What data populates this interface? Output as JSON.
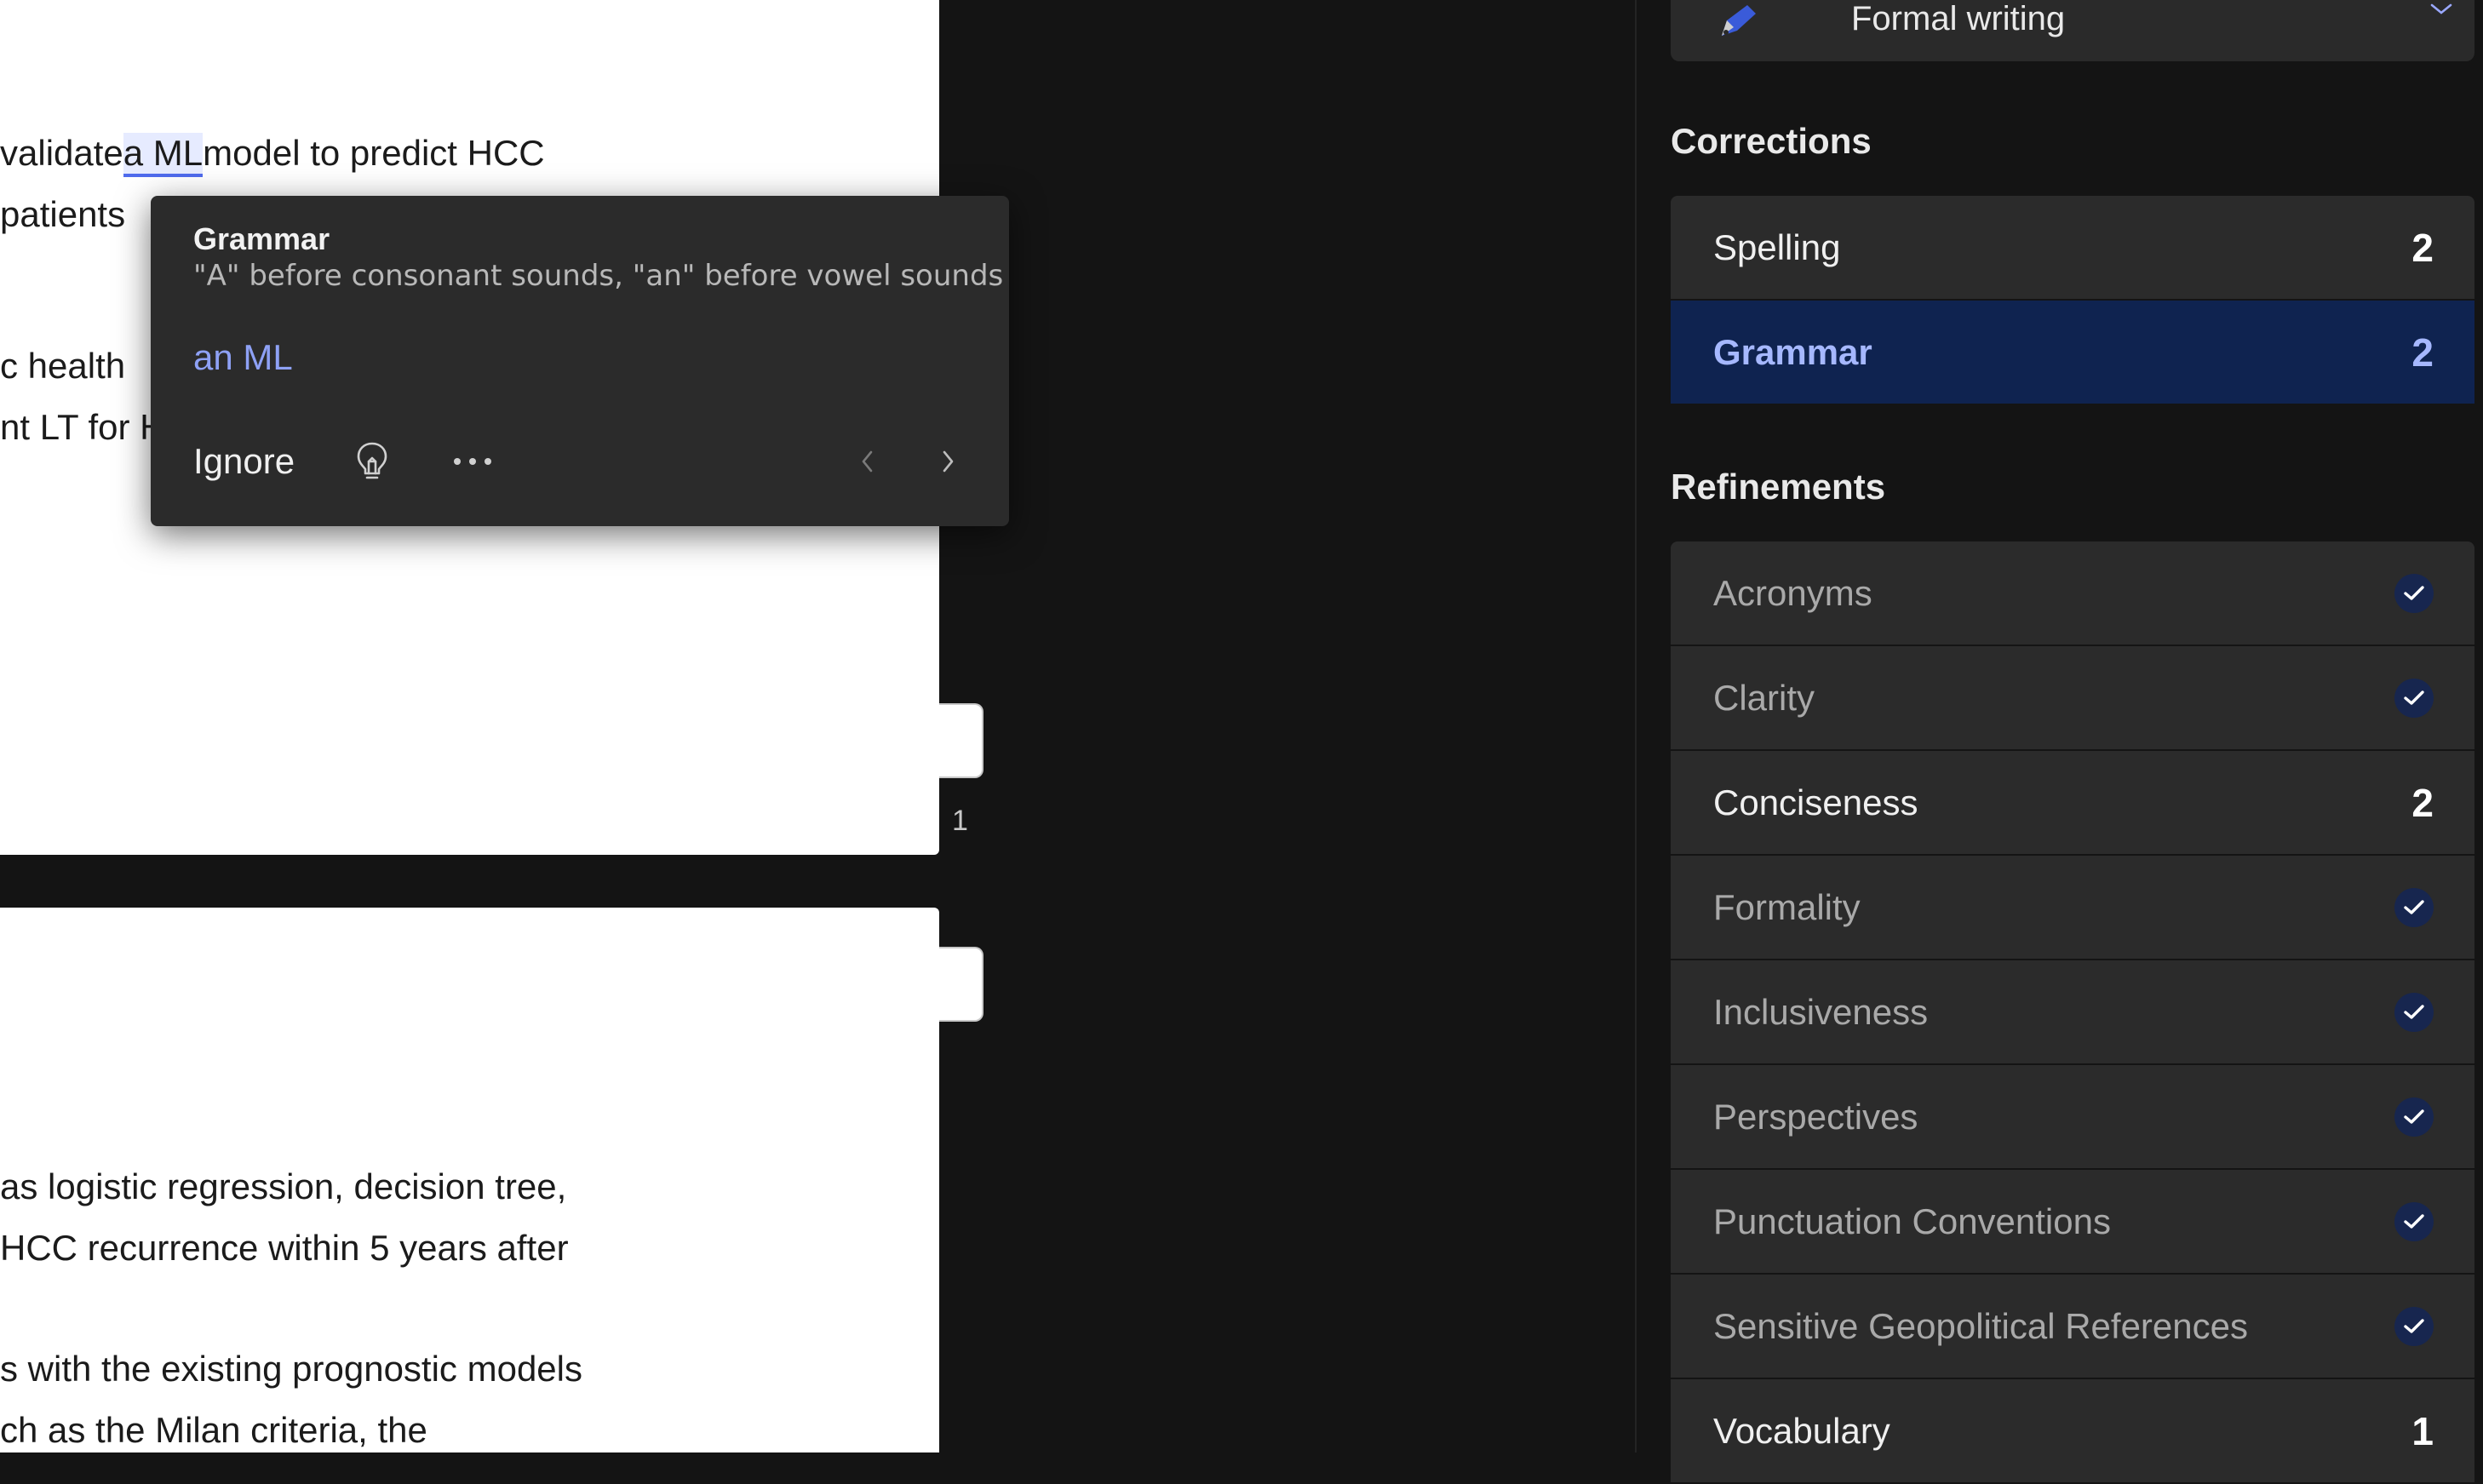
{
  "document": {
    "page1_lines": [
      {
        "before": "validate ",
        "flagged": "a ML",
        "after": " model to predict HCC"
      },
      {
        "before": "patients",
        "flagged": "",
        "after": ""
      },
      {
        "before": "c health",
        "flagged": "",
        "after": ""
      },
      {
        "before": "nt LT for H",
        "flagged": "",
        "after": ""
      }
    ],
    "page_number": "1",
    "page2_lines": [
      "as logistic regression, decision tree,",
      "HCC recurrence within 5 years after",
      "s with the existing prognostic models",
      "ch as the Milan criteria, the"
    ]
  },
  "card": {
    "category": "Grammar",
    "explanation": "\"A\" before consonant sounds, \"an\" before vowel sounds",
    "suggestion": "an ML",
    "ignore_label": "Ignore",
    "icons": {
      "lightbulb": "lightbulb-icon",
      "more": "more-options-icon",
      "prev": "chevron-left-icon",
      "next": "chevron-right-icon"
    }
  },
  "pane": {
    "style_label": "Formal writing",
    "corrections_heading": "Corrections",
    "corrections": [
      {
        "label": "Spelling",
        "count": "2",
        "selected": false
      },
      {
        "label": "Grammar",
        "count": "2",
        "selected": true
      }
    ],
    "refinements_heading": "Refinements",
    "refinements": [
      {
        "label": "Acronyms",
        "count": "",
        "done": true
      },
      {
        "label": "Clarity",
        "count": "",
        "done": true
      },
      {
        "label": "Conciseness",
        "count": "2",
        "done": false
      },
      {
        "label": "Formality",
        "count": "",
        "done": true
      },
      {
        "label": "Inclusiveness",
        "count": "",
        "done": true
      },
      {
        "label": "Perspectives",
        "count": "",
        "done": true
      },
      {
        "label": "Punctuation Conventions",
        "count": "",
        "done": true
      },
      {
        "label": "Sensitive Geopolitical References",
        "count": "",
        "done": true
      },
      {
        "label": "Vocabulary",
        "count": "1",
        "done": false
      }
    ]
  },
  "colors": {
    "accent": "#8ea1f5",
    "selected_row": "#0f2350",
    "flag_underline": "#4f6bed"
  }
}
